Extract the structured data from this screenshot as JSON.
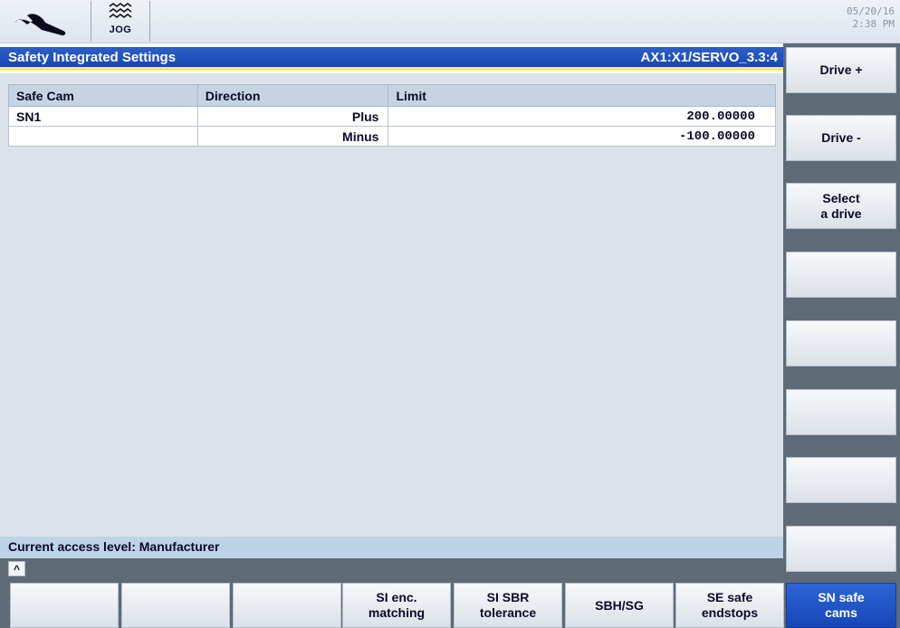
{
  "status_bar": {
    "mode": "JOG",
    "date": "05/20/16",
    "time": "2:38 PM"
  },
  "title_bar": {
    "title": "Safety Integrated Settings",
    "axis": "AX1:X1/SERVO_3.3:4"
  },
  "table": {
    "headers": [
      "Safe Cam",
      "Direction",
      "Limit"
    ],
    "rows": [
      {
        "cam": "SN1",
        "direction": "Plus",
        "limit": "200.00000"
      },
      {
        "cam": "",
        "direction": "Minus",
        "limit": "-100.00000"
      }
    ]
  },
  "access_level": "Current access level: Manufacturer",
  "vertical_softkeys": [
    "Drive +",
    "Drive -",
    "Select\na drive",
    "",
    "",
    "",
    "",
    ""
  ],
  "horizontal_softkeys": [
    "",
    "",
    "",
    "SI enc.\nmatching",
    "SI SBR\ntolerance",
    "SBH/SG",
    "SE safe\nendstops",
    "SN safe\ncams"
  ],
  "active_horizontal_softkey": "SN safe cams",
  "colors": {
    "title_blue": "#1f4fbf",
    "highlight_yellow": "#f4e87a",
    "softkey_bar": "#5f6a77",
    "panel_bg": "#dde3ea"
  },
  "icons": {
    "machine": "wrench-icon",
    "mode": "jog-wave-icon"
  }
}
